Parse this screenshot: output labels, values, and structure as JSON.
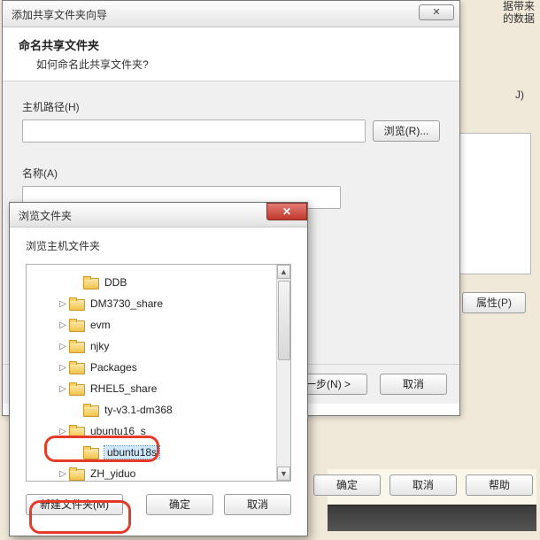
{
  "background": {
    "side_text_line1": "据带来",
    "side_text_line2": "的数据",
    "side_text_line3": "J)",
    "properties_btn": "属性(P)",
    "bottom_ok": "确定",
    "bottom_cancel": "取消",
    "bottom_help": "帮助"
  },
  "wizard": {
    "window_title": "添加共享文件夹向导",
    "close_glyph": "✕",
    "heading": "命名共享文件夹",
    "subheading": "如何命名此共享文件夹?",
    "host_path_label": "主机路径(H)",
    "host_path_value": "",
    "browse_btn": "浏览(R)...",
    "name_label": "名称(A)",
    "name_value": "",
    "next_btn": "下一步(N) >",
    "cancel_btn": "取消"
  },
  "browse": {
    "window_title": "浏览文件夹",
    "close_glyph": "✕",
    "subtitle": "浏览主机文件夹",
    "tree": [
      {
        "indent": 2,
        "expander": "",
        "label": "DDB"
      },
      {
        "indent": 1,
        "expander": "▷",
        "label": "DM3730_share"
      },
      {
        "indent": 1,
        "expander": "▷",
        "label": "evm"
      },
      {
        "indent": 1,
        "expander": "▷",
        "label": "njky"
      },
      {
        "indent": 1,
        "expander": "▷",
        "label": "Packages"
      },
      {
        "indent": 1,
        "expander": "▷",
        "label": "RHEL5_share"
      },
      {
        "indent": 2,
        "expander": "",
        "label": "ty-v3.1-dm368"
      },
      {
        "indent": 1,
        "expander": "▷",
        "label": "ubuntu16_s"
      },
      {
        "indent": 2,
        "expander": "",
        "label": "ubuntu18s",
        "selected": true
      },
      {
        "indent": 1,
        "expander": "▷",
        "label": "ZH_yiduo"
      }
    ],
    "scroll_up": "▲",
    "scroll_down": "▼",
    "new_folder_btn": "新建文件夹(M)",
    "ok_btn": "确定",
    "cancel_btn": "取消"
  }
}
